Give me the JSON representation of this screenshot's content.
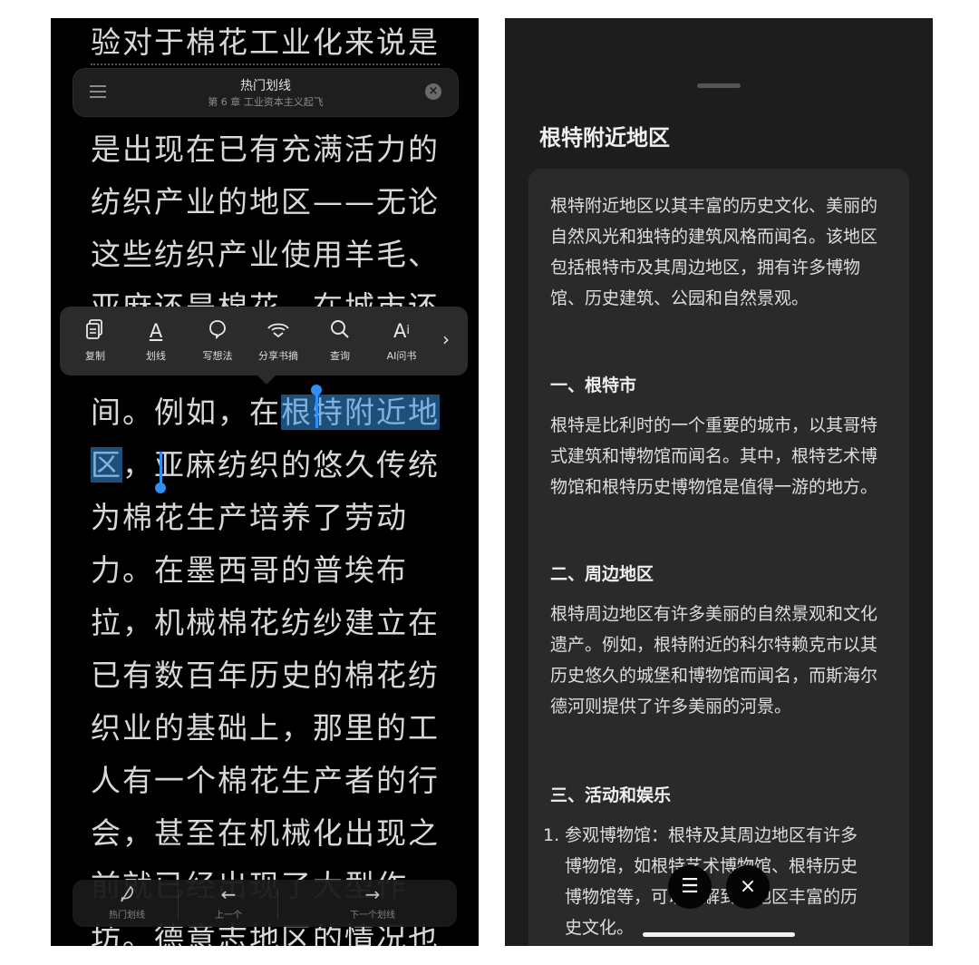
{
  "reader": {
    "lines": [
      "验对于棉花工业化来说是",
      "是出现在已有充满活力的",
      "纺织产业的地区——无论",
      "这些纺织产业使用羊毛、",
      "亚麻还是棉花，在城市还",
      "间。例如，在",
      "根特附近地",
      "区",
      "，亚麻纺织的悠久传统",
      "为棉花生产培养了劳动",
      "力。在墨西哥的普埃布",
      "拉，机械棉花纺纱建立在",
      "已有数百年历史的棉花纺",
      "织业的基础上，那里的工",
      "人有一个棉花生产者的行",
      "会，甚至在机械化出现之",
      "前就已经出现了大型作",
      "坊。德意志地区的情况也"
    ]
  },
  "hot_highlights_bar": {
    "title": "热门划线",
    "chapter": "第 6 章 工业资本主义起飞",
    "menu_icon": "menu-icon",
    "close_icon": "close-icon"
  },
  "selection_toolbar": {
    "items": [
      {
        "label": "复制",
        "icon": "copy-icon"
      },
      {
        "label": "划线",
        "icon": "underline-icon"
      },
      {
        "label": "写想法",
        "icon": "thought-icon"
      },
      {
        "label": "分享书摘",
        "icon": "share-icon"
      },
      {
        "label": "查询",
        "icon": "search-icon"
      },
      {
        "label": "AI问书",
        "icon": "ai-icon"
      }
    ],
    "more_glyph": "›"
  },
  "bottom_bar": {
    "items": [
      {
        "label": "热门划线",
        "glyph": "𝓅"
      },
      {
        "label": "上一个",
        "glyph": "←"
      },
      {
        "label": "下一个划线",
        "glyph": "→"
      }
    ]
  },
  "ai_panel": {
    "title": "根特附近地区",
    "intro": "根特附近地区以其丰富的历史文化、美丽的自然风光和独特的建筑风格而闻名。该地区包括根特市及其周边地区，拥有许多博物馆、历史建筑、公园和自然景观。",
    "section1_title": "一、根特市",
    "section1_body": "根特是比利时的一个重要的城市，以其哥特式建筑和博物馆而闻名。其中，根特艺术博物馆和根特历史博物馆是值得一游的地方。",
    "section2_title": "二、周边地区",
    "section2_body": "根特周边地区有许多美丽的自然景观和文化遗产。例如，根特附近的科尔特赖克市以其历史悠久的城堡和博物馆而闻名，而斯海尔德河则提供了许多美丽的河景。",
    "section3_title": "三、活动和娱乐",
    "list_num": "1.",
    "list_item1": "参观博物馆：根特及其周边地区有许多博物馆，如根特艺术博物馆、根特历史博物馆等，可以了解到该地区丰富的历史文化。",
    "menu_button": "☰",
    "close_button": "×"
  }
}
